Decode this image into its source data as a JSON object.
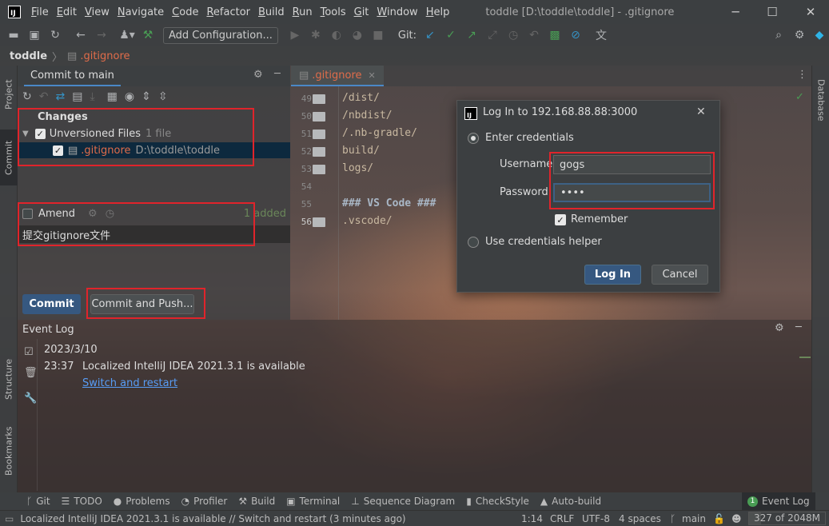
{
  "window": {
    "title": "toddle [D:\\toddle\\toddle] - .gitignore"
  },
  "menu": [
    {
      "label": "File",
      "mnemonic": "F",
      "rest": "ile"
    },
    {
      "label": "Edit",
      "mnemonic": "E",
      "rest": "dit"
    },
    {
      "label": "View",
      "mnemonic": "V",
      "rest": "iew"
    },
    {
      "label": "Navigate",
      "mnemonic": "N",
      "rest": "avigate"
    },
    {
      "label": "Code",
      "mnemonic": "C",
      "rest": "ode"
    },
    {
      "label": "Refactor",
      "mnemonic": "R",
      "rest": "efactor"
    },
    {
      "label": "Build",
      "mnemonic": "B",
      "rest": "uild"
    },
    {
      "label": "Run",
      "mnemonic": "R",
      "rest": "un"
    },
    {
      "label": "Tools",
      "mnemonic": "T",
      "rest": "ools"
    },
    {
      "label": "Git",
      "mnemonic": "G",
      "rest": "it"
    },
    {
      "label": "Window",
      "mnemonic": "W",
      "rest": "indow"
    },
    {
      "label": "Help",
      "mnemonic": "H",
      "rest": "elp"
    }
  ],
  "toolbar": {
    "add_configuration": "Add Configuration...",
    "git_label": "Git:"
  },
  "breadcrumb": {
    "project": "toddle",
    "file": ".gitignore"
  },
  "side_tabs": {
    "project": "Project",
    "commit": "Commit",
    "structure": "Structure",
    "bookmarks": "Bookmarks",
    "database": "Database"
  },
  "commit": {
    "header": "Commit to main",
    "changes_label": "Changes",
    "unversioned_label": "Unversioned Files",
    "unversioned_count": "1 file",
    "file_name": ".gitignore",
    "file_path": "D:\\toddle\\toddle",
    "amend_label": "Amend",
    "added_label": "1 added",
    "message": "提交gitignore文件",
    "commit_button": "Commit",
    "commit_push_button": "Commit and Push..."
  },
  "editor": {
    "tab_label": ".gitignore",
    "lines": [
      {
        "num": "49",
        "text": "/dist/",
        "folder": true
      },
      {
        "num": "50",
        "text": "/nbdist/",
        "folder": true
      },
      {
        "num": "51",
        "text": "/.nb-gradle/",
        "folder": true
      },
      {
        "num": "52",
        "text": "build/",
        "folder": true
      },
      {
        "num": "53",
        "text": "logs/",
        "folder": true
      },
      {
        "num": "54",
        "text": "",
        "folder": false
      },
      {
        "num": "55",
        "text": "### VS Code ###",
        "folder": false
      },
      {
        "num": "56",
        "text": ".vscode/",
        "folder": true
      }
    ]
  },
  "dialog": {
    "title": "Log In to 192.168.88.88:3000",
    "enter_credentials": "Enter credentials",
    "username_label": "Username:",
    "username_value": "gogs",
    "password_label": "Password:",
    "password_value": "••••",
    "remember_label": "Remember",
    "helper_label": "Use credentials helper",
    "login_button": "Log In",
    "cancel_button": "Cancel"
  },
  "event_log": {
    "title": "Event Log",
    "date": "2023/3/10",
    "time": "23:37",
    "message": "Localized IntelliJ IDEA 2021.3.1 is available",
    "link": "Switch and restart"
  },
  "bottom_tabs": [
    {
      "icon": "git-icon",
      "glyph": "ᚴ",
      "label": "Git"
    },
    {
      "icon": "todo-icon",
      "glyph": "☰",
      "label": "TODO"
    },
    {
      "icon": "problems-icon",
      "glyph": "●",
      "label": "Problems"
    },
    {
      "icon": "profiler-icon",
      "glyph": "◔",
      "label": "Profiler"
    },
    {
      "icon": "build-icon",
      "glyph": "⚒",
      "label": "Build"
    },
    {
      "icon": "terminal-icon",
      "glyph": "▣",
      "label": "Terminal"
    },
    {
      "icon": "sequence-diagram-icon",
      "glyph": "⊥",
      "label": "Sequence Diagram"
    },
    {
      "icon": "checkstyle-icon",
      "glyph": "▮",
      "label": "CheckStyle"
    },
    {
      "icon": "auto-build-icon",
      "glyph": "▲",
      "label": "Auto-build"
    }
  ],
  "event_log_tab": {
    "badge": "1",
    "label": "Event Log"
  },
  "status": {
    "message": "Localized IntelliJ IDEA 2021.3.1 is available // Switch and restart (3 minutes ago)",
    "position": "1:14",
    "line_sep": "CRLF",
    "encoding": "UTF-8",
    "indent": "4 spaces",
    "branch": "main",
    "memory": "327 of 2048M",
    "memory_used_fraction": 0.16
  },
  "colors": {
    "accent": "#365880",
    "link": "#589df6",
    "highlight_red": "#e0242b",
    "git_check": "#499c54"
  }
}
